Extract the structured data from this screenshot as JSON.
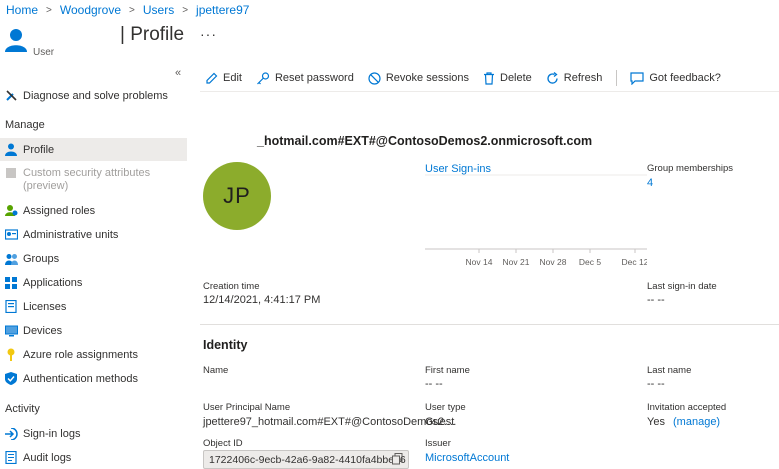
{
  "breadcrumb": {
    "items": [
      "Home",
      "Woodgrove",
      "Users",
      "jpettere97"
    ]
  },
  "header": {
    "subtitle": "User",
    "title": "| Profile",
    "more": "···"
  },
  "sidebar": {
    "collapse": "«",
    "items_top": [
      {
        "label": "Diagnose and solve problems",
        "icon": "wrench-icon"
      }
    ],
    "manage_title": "Manage",
    "manage_items": [
      {
        "label": "Profile",
        "icon": "person-icon",
        "active": true
      },
      {
        "label": "Custom security attributes",
        "label2": "(preview)",
        "icon": "tag-icon",
        "disabled": true
      },
      {
        "label": "Assigned roles",
        "icon": "roles-icon"
      },
      {
        "label": "Administrative units",
        "icon": "admin-units-icon"
      },
      {
        "label": "Groups",
        "icon": "groups-icon"
      },
      {
        "label": "Applications",
        "icon": "apps-icon"
      },
      {
        "label": "Licenses",
        "icon": "license-icon"
      },
      {
        "label": "Devices",
        "icon": "device-icon"
      },
      {
        "label": "Azure role assignments",
        "icon": "key-icon"
      },
      {
        "label": "Authentication methods",
        "icon": "shield-icon"
      }
    ],
    "activity_title": "Activity",
    "activity_items": [
      {
        "label": "Sign-in logs",
        "icon": "signin-icon"
      },
      {
        "label": "Audit logs",
        "icon": "audit-icon"
      }
    ]
  },
  "toolbar": {
    "edit": "Edit",
    "reset_password": "Reset password",
    "revoke_sessions": "Revoke sessions",
    "delete": "Delete",
    "refresh": "Refresh",
    "feedback": "Got feedback?"
  },
  "profile": {
    "upn_heading": "_hotmail.com#EXT#@ContosoDemos2.onmicrosoft.com",
    "initials": "JP",
    "avatar_color": "#8cac2c",
    "signins_link": "User Sign-ins",
    "chart_ticks": [
      "Nov 14",
      "Nov 21",
      "Nov 28",
      "Dec 5",
      "Dec 12"
    ],
    "group_memberships_label": "Group memberships",
    "group_memberships_value": "4",
    "creation_time_label": "Creation time",
    "creation_time_value": "12/14/2021, 4:41:17 PM",
    "last_signin_label": "Last sign-in date",
    "last_signin_value": "-- --"
  },
  "identity": {
    "title": "Identity",
    "name_label": "Name",
    "first_name_label": "First name",
    "first_name_value": "-- --",
    "last_name_label": "Last name",
    "last_name_value": "-- --",
    "upn_label": "User Principal Name",
    "upn_value": "jpettere97_hotmail.com#EXT#@ContosoDemos2....",
    "user_type_label": "User type",
    "user_type_value": "Guest",
    "invitation_label": "Invitation accepted",
    "invitation_value": "Yes",
    "invitation_manage": "(manage)",
    "object_id_label": "Object ID",
    "object_id_value": "1722406c-9ecb-42a6-9a82-4410fa4bbe16",
    "issuer_label": "Issuer",
    "issuer_value": "MicrosoftAccount"
  },
  "colors": {
    "accent": "#0078d4",
    "avatar": "#8cac2c",
    "active_nav": "#edebe9"
  }
}
